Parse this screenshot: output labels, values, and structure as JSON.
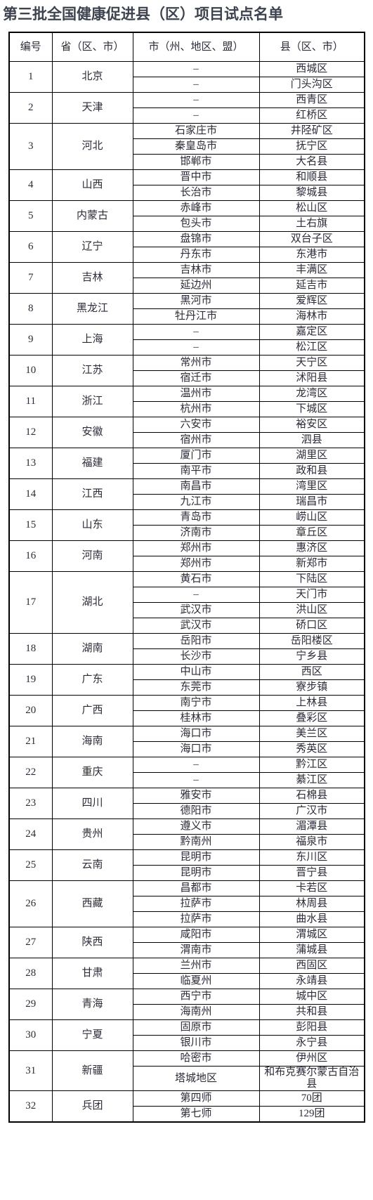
{
  "title": "第三批全国健康促进县（区）项目试点名单",
  "table": {
    "headers": [
      "编号",
      "省（区、市）",
      "市（州、地区、盟）",
      "县（区、市）"
    ],
    "rows": [
      {
        "no": "1",
        "province": "北京",
        "entries": [
          [
            "–",
            "西城区"
          ],
          [
            "–",
            "门头沟区"
          ]
        ]
      },
      {
        "no": "2",
        "province": "天津",
        "entries": [
          [
            "–",
            "西青区"
          ],
          [
            "–",
            "红桥区"
          ]
        ]
      },
      {
        "no": "3",
        "province": "河北",
        "entries": [
          [
            "石家庄市",
            "井陉矿区"
          ],
          [
            "秦皇岛市",
            "抚宁区"
          ],
          [
            "邯郸市",
            "大名县"
          ]
        ]
      },
      {
        "no": "4",
        "province": "山西",
        "entries": [
          [
            "晋中市",
            "和顺县"
          ],
          [
            "长治市",
            "黎城县"
          ]
        ]
      },
      {
        "no": "5",
        "province": "内蒙古",
        "entries": [
          [
            "赤峰市",
            "松山区"
          ],
          [
            "包头市",
            "土右旗"
          ]
        ]
      },
      {
        "no": "6",
        "province": "辽宁",
        "entries": [
          [
            "盘锦市",
            "双台子区"
          ],
          [
            "丹东市",
            "东港市"
          ]
        ]
      },
      {
        "no": "7",
        "province": "吉林",
        "entries": [
          [
            "吉林市",
            "丰满区"
          ],
          [
            "延边州",
            "延吉市"
          ]
        ]
      },
      {
        "no": "8",
        "province": "黑龙江",
        "entries": [
          [
            "黑河市",
            "爱辉区"
          ],
          [
            "牡丹江市",
            "海林市"
          ]
        ]
      },
      {
        "no": "9",
        "province": "上海",
        "entries": [
          [
            "–",
            "嘉定区"
          ],
          [
            "–",
            "松江区"
          ]
        ]
      },
      {
        "no": "10",
        "province": "江苏",
        "entries": [
          [
            "常州市",
            "天宁区"
          ],
          [
            "宿迁市",
            "沭阳县"
          ]
        ]
      },
      {
        "no": "11",
        "province": "浙江",
        "entries": [
          [
            "温州市",
            "龙湾区"
          ],
          [
            "杭州市",
            "下城区"
          ]
        ]
      },
      {
        "no": "12",
        "province": "安徽",
        "entries": [
          [
            "六安市",
            "裕安区"
          ],
          [
            "宿州市",
            "泗县"
          ]
        ]
      },
      {
        "no": "13",
        "province": "福建",
        "entries": [
          [
            "厦门市",
            "湖里区"
          ],
          [
            "南平市",
            "政和县"
          ]
        ]
      },
      {
        "no": "14",
        "province": "江西",
        "entries": [
          [
            "南昌市",
            "湾里区"
          ],
          [
            "九江市",
            "瑞昌市"
          ]
        ]
      },
      {
        "no": "15",
        "province": "山东",
        "entries": [
          [
            "青岛市",
            "崂山区"
          ],
          [
            "济南市",
            "章丘区"
          ]
        ]
      },
      {
        "no": "16",
        "province": "河南",
        "entries": [
          [
            "郑州市",
            "惠济区"
          ],
          [
            "郑州市",
            "新郑市"
          ]
        ]
      },
      {
        "no": "17",
        "province": "湖北",
        "entries": [
          [
            "黄石市",
            "下陆区"
          ],
          [
            "–",
            "天门市"
          ],
          [
            "武汉市",
            "洪山区"
          ],
          [
            "武汉市",
            "硚口区"
          ]
        ]
      },
      {
        "no": "18",
        "province": "湖南",
        "entries": [
          [
            "岳阳市",
            "岳阳楼区"
          ],
          [
            "长沙市",
            "宁乡县"
          ]
        ]
      },
      {
        "no": "19",
        "province": "广东",
        "entries": [
          [
            "中山市",
            "西区"
          ],
          [
            "东莞市",
            "寮步镇"
          ]
        ]
      },
      {
        "no": "20",
        "province": "广西",
        "entries": [
          [
            "南宁市",
            "上林县"
          ],
          [
            "桂林市",
            "叠彩区"
          ]
        ]
      },
      {
        "no": "21",
        "province": "海南",
        "entries": [
          [
            "海口市",
            "美兰区"
          ],
          [
            "海口市",
            "秀英区"
          ]
        ]
      },
      {
        "no": "22",
        "province": "重庆",
        "entries": [
          [
            "–",
            "黔江区"
          ],
          [
            "–",
            "綦江区"
          ]
        ]
      },
      {
        "no": "23",
        "province": "四川",
        "entries": [
          [
            "雅安市",
            "石棉县"
          ],
          [
            "德阳市",
            "广汉市"
          ]
        ]
      },
      {
        "no": "24",
        "province": "贵州",
        "entries": [
          [
            "遵义市",
            "湄潭县"
          ],
          [
            "黔南州",
            "福泉市"
          ]
        ]
      },
      {
        "no": "25",
        "province": "云南",
        "entries": [
          [
            "昆明市",
            "东川区"
          ],
          [
            "昆明市",
            "晋宁县"
          ]
        ]
      },
      {
        "no": "26",
        "province": "西藏",
        "entries": [
          [
            "昌都市",
            "卡若区"
          ],
          [
            "拉萨市",
            "林周县"
          ],
          [
            "拉萨市",
            "曲水县"
          ]
        ]
      },
      {
        "no": "27",
        "province": "陕西",
        "entries": [
          [
            "咸阳市",
            "渭城区"
          ],
          [
            "渭南市",
            "蒲城县"
          ]
        ]
      },
      {
        "no": "28",
        "province": "甘肃",
        "entries": [
          [
            "兰州市",
            "西固区"
          ],
          [
            "临夏州",
            "永靖县"
          ]
        ]
      },
      {
        "no": "29",
        "province": "青海",
        "entries": [
          [
            "西宁市",
            "城中区"
          ],
          [
            "海南州",
            "共和县"
          ]
        ]
      },
      {
        "no": "30",
        "province": "宁夏",
        "entries": [
          [
            "固原市",
            "彭阳县"
          ],
          [
            "银川市",
            "永宁县"
          ]
        ]
      },
      {
        "no": "31",
        "province": "新疆",
        "entries": [
          [
            "哈密市",
            "伊州区"
          ],
          [
            "塔城地区",
            "和布克赛尔蒙古自治县"
          ]
        ]
      },
      {
        "no": "32",
        "province": "兵团",
        "entries": [
          [
            "第四师",
            "70团"
          ],
          [
            "第七师",
            "129团"
          ]
        ]
      }
    ]
  }
}
